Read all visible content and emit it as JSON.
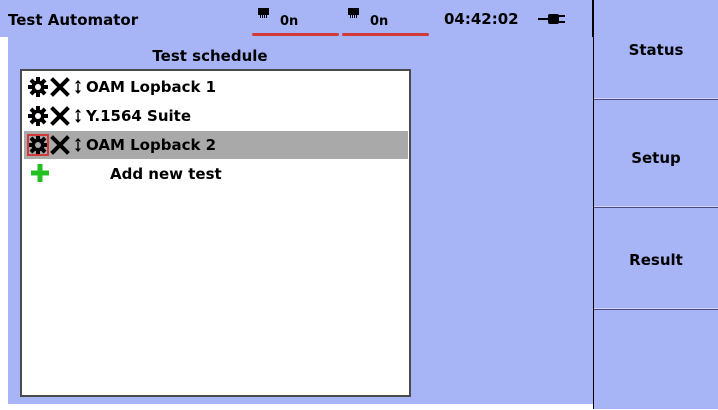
{
  "header": {
    "app_title": "Test Automator",
    "port1_value": "0n",
    "port2_value": "0n",
    "clock": "04:42:02"
  },
  "schedule": {
    "title": "Test schedule",
    "tests": [
      {
        "label": "OAM Lopback 1",
        "selected": false
      },
      {
        "label": "Y.1564 Suite",
        "selected": false
      },
      {
        "label": "OAM Lopback 2",
        "selected": true
      }
    ],
    "add_label": "Add new test"
  },
  "softkeys": [
    {
      "label": "Status"
    },
    {
      "label": "Setup"
    },
    {
      "label": "Result"
    },
    {
      "label": ""
    }
  ],
  "colors": {
    "panel_background": "#a7b4f6",
    "selected_row": "#a9a9a9",
    "add_icon": "#22c022",
    "focus_outline": "#d23a3a"
  }
}
